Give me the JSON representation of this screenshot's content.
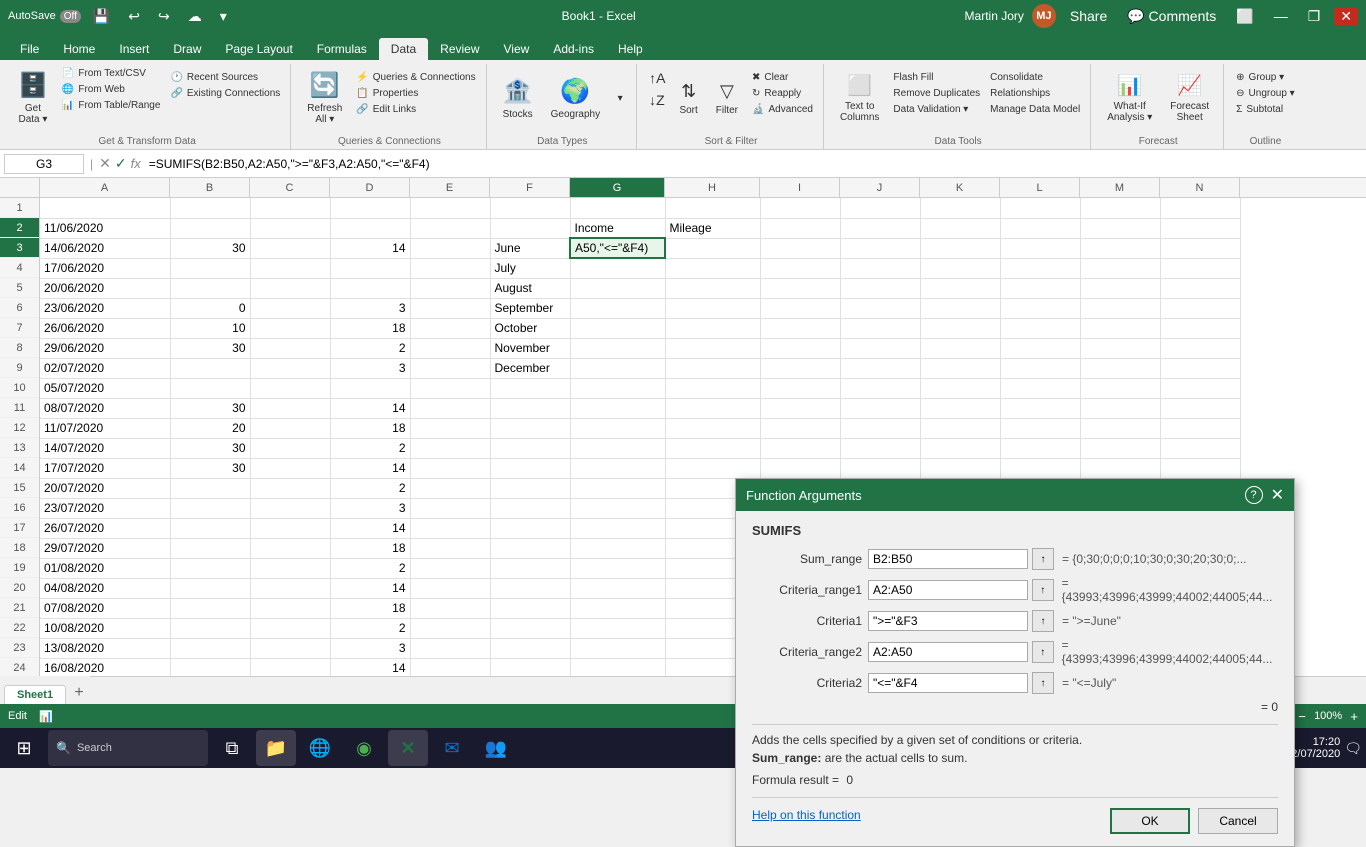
{
  "titlebar": {
    "autosave_label": "AutoSave",
    "autosave_state": "Off",
    "workbook_name": "Book1 - Excel",
    "user_name": "Martin Jory",
    "user_initials": "MJ",
    "minimize": "—",
    "restore": "❐",
    "close": "✕"
  },
  "ribbon": {
    "tabs": [
      "File",
      "Home",
      "Insert",
      "Draw",
      "Page Layout",
      "Formulas",
      "Data",
      "Review",
      "View",
      "Add-ins",
      "Help"
    ],
    "active_tab": "Data",
    "groups": {
      "get_transform": {
        "label": "Get & Transform Data",
        "buttons": [
          {
            "id": "get-data",
            "label": "Get\nData",
            "icon": "💾"
          },
          {
            "id": "from-text-csv",
            "label": "From Text/CSV",
            "icon": "📄"
          },
          {
            "id": "from-web",
            "label": "From Web",
            "icon": "🌐"
          },
          {
            "id": "from-table",
            "label": "From Table/Range",
            "icon": "📊"
          },
          {
            "id": "recent-sources",
            "label": "Recent Sources"
          },
          {
            "id": "existing-connections",
            "label": "Existing Connections"
          }
        ]
      },
      "queries": {
        "label": "Queries & Connections",
        "buttons": [
          {
            "id": "refresh-all",
            "label": "Refresh\nAll",
            "icon": "🔄"
          },
          {
            "id": "queries-connections",
            "label": "Queries & Connections"
          },
          {
            "id": "properties",
            "label": "Properties"
          },
          {
            "id": "edit-links",
            "label": "Edit Links"
          }
        ]
      },
      "data_types": {
        "label": "Data Types",
        "buttons": [
          {
            "id": "stocks",
            "label": "Stocks",
            "icon": "🏦"
          },
          {
            "id": "geography",
            "label": "Geography",
            "icon": "🌍"
          }
        ]
      },
      "sort_filter": {
        "label": "Sort & Filter",
        "buttons": [
          {
            "id": "sort-az",
            "label": "A→Z",
            "icon": "↑"
          },
          {
            "id": "sort-za",
            "label": "Z→A",
            "icon": "↓"
          },
          {
            "id": "sort",
            "label": "Sort"
          },
          {
            "id": "filter",
            "label": "Filter"
          },
          {
            "id": "clear",
            "label": "Clear"
          },
          {
            "id": "reapply",
            "label": "Reapply"
          },
          {
            "id": "advanced",
            "label": "Advanced"
          }
        ]
      },
      "data_tools": {
        "label": "Data Tools",
        "buttons": [
          {
            "id": "text-to-columns",
            "label": "Text to\nColumns",
            "icon": "⬜"
          },
          {
            "id": "flash-fill",
            "label": "Flash Fill"
          },
          {
            "id": "remove-duplicates",
            "label": "Remove Duplicates"
          },
          {
            "id": "data-validation",
            "label": "Data Validation"
          },
          {
            "id": "consolidate",
            "label": "Consolidate"
          },
          {
            "id": "relationships",
            "label": "Relationships"
          },
          {
            "id": "manage-data-model",
            "label": "Manage Data Model"
          }
        ]
      },
      "forecast": {
        "label": "Forecast",
        "buttons": [
          {
            "id": "what-if",
            "label": "What-If\nAnalysis"
          },
          {
            "id": "forecast-sheet",
            "label": "Forecast\nSheet"
          }
        ]
      },
      "outline": {
        "label": "Outline",
        "buttons": [
          {
            "id": "group",
            "label": "Group"
          },
          {
            "id": "ungroup",
            "label": "Ungroup"
          },
          {
            "id": "subtotal",
            "label": "Subtotal"
          }
        ]
      }
    }
  },
  "formula_bar": {
    "cell_ref": "G3",
    "formula": "=SUMIFS(B2:B50,A2:A50,\">=\"&F3,A2:A50,\"<=\"&F4)"
  },
  "columns": {
    "headers": [
      "A",
      "B",
      "C",
      "D",
      "E",
      "F",
      "G",
      "H",
      "I",
      "J",
      "K",
      "L",
      "M",
      "N"
    ],
    "widths": [
      130,
      80,
      80,
      80,
      80,
      80,
      95,
      95,
      80,
      80,
      80,
      80,
      80,
      80
    ]
  },
  "rows": [
    {
      "num": 2,
      "A": "11/06/2020",
      "B": "",
      "C": "",
      "D": "",
      "E": "",
      "F": "",
      "G": "Income",
      "H": "Mileage"
    },
    {
      "num": 3,
      "A": "14/06/2020",
      "B": "30",
      "C": "",
      "D": "14",
      "E": "",
      "F": "June",
      "G": "A50,\"<=\"&F4)",
      "H": ""
    },
    {
      "num": 4,
      "A": "17/06/2020",
      "B": "",
      "C": "",
      "D": "",
      "E": "",
      "F": "July",
      "G": "",
      "H": ""
    },
    {
      "num": 5,
      "A": "20/06/2020",
      "B": "",
      "C": "",
      "D": "",
      "E": "",
      "F": "August",
      "G": "",
      "H": ""
    },
    {
      "num": 6,
      "A": "23/06/2020",
      "B": "0",
      "C": "",
      "D": "3",
      "E": "",
      "F": "September",
      "G": "",
      "H": ""
    },
    {
      "num": 7,
      "A": "26/06/2020",
      "B": "10",
      "C": "",
      "D": "18",
      "E": "",
      "F": "October",
      "G": "",
      "H": ""
    },
    {
      "num": 8,
      "A": "29/06/2020",
      "B": "30",
      "C": "",
      "D": "2",
      "E": "",
      "F": "November",
      "G": "",
      "H": ""
    },
    {
      "num": 9,
      "A": "02/07/2020",
      "B": "",
      "C": "",
      "D": "3",
      "E": "",
      "F": "December",
      "G": "",
      "H": ""
    },
    {
      "num": 10,
      "A": "05/07/2020",
      "B": "",
      "C": "",
      "D": "",
      "E": "",
      "F": "",
      "G": "",
      "H": ""
    },
    {
      "num": 11,
      "A": "08/07/2020",
      "B": "30",
      "C": "",
      "D": "14",
      "E": "",
      "F": "",
      "G": "",
      "H": ""
    },
    {
      "num": 12,
      "A": "11/07/2020",
      "B": "20",
      "C": "",
      "D": "18",
      "E": "",
      "F": "",
      "G": "",
      "H": ""
    },
    {
      "num": 13,
      "A": "14/07/2020",
      "B": "30",
      "C": "",
      "D": "2",
      "E": "",
      "F": "",
      "G": "",
      "H": ""
    },
    {
      "num": 14,
      "A": "17/07/2020",
      "B": "30",
      "C": "",
      "D": "14",
      "E": "",
      "F": "",
      "G": "",
      "H": ""
    },
    {
      "num": 15,
      "A": "20/07/2020",
      "B": "",
      "C": "",
      "D": "2",
      "E": "",
      "F": "",
      "G": "",
      "H": ""
    },
    {
      "num": 16,
      "A": "23/07/2020",
      "B": "",
      "C": "",
      "D": "3",
      "E": "",
      "F": "",
      "G": "",
      "H": ""
    },
    {
      "num": 17,
      "A": "26/07/2020",
      "B": "",
      "C": "",
      "D": "14",
      "E": "",
      "F": "",
      "G": "",
      "H": ""
    },
    {
      "num": 18,
      "A": "29/07/2020",
      "B": "",
      "C": "",
      "D": "18",
      "E": "",
      "F": "",
      "G": "",
      "H": ""
    },
    {
      "num": 19,
      "A": "01/08/2020",
      "B": "",
      "C": "",
      "D": "2",
      "E": "",
      "F": "",
      "G": "",
      "H": ""
    },
    {
      "num": 20,
      "A": "04/08/2020",
      "B": "",
      "C": "",
      "D": "14",
      "E": "",
      "F": "",
      "G": "",
      "H": ""
    },
    {
      "num": 21,
      "A": "07/08/2020",
      "B": "",
      "C": "",
      "D": "18",
      "E": "",
      "F": "",
      "G": "",
      "H": ""
    },
    {
      "num": 22,
      "A": "10/08/2020",
      "B": "",
      "C": "",
      "D": "2",
      "E": "",
      "F": "",
      "G": "",
      "H": ""
    },
    {
      "num": 23,
      "A": "13/08/2020",
      "B": "",
      "C": "",
      "D": "3",
      "E": "",
      "F": "",
      "G": "",
      "H": ""
    },
    {
      "num": 24,
      "A": "16/08/2020",
      "B": "",
      "C": "",
      "D": "14",
      "E": "",
      "F": "",
      "G": "",
      "H": ""
    }
  ],
  "dialog": {
    "title": "Function Arguments",
    "help_icon": "?",
    "close_icon": "✕",
    "func_name": "SUMIFS",
    "fields": [
      {
        "label": "Sum_range",
        "value": "B2:B50",
        "result": "= {0;30;0;0;0;10;30;0;30;20;30;0;..."
      },
      {
        "label": "Criteria_range1",
        "value": "A2:A50",
        "result": "= {43993;43996;43999;44002;44005;44..."
      },
      {
        "label": "Criteria1",
        "value": "\">=\" & F3",
        "result": "= \">= June\""
      },
      {
        "label": "Criteria_range2",
        "value": "A2:A50",
        "result": "= {43993;43996;43999;44002;44005;44..."
      },
      {
        "label": "Criteria2",
        "value": "\"<=\" & F4",
        "result": "= \"<= July\""
      }
    ],
    "equals_result": "= 0",
    "description": "Adds the cells specified by a given set of conditions or criteria.",
    "param_name": "Sum_range:",
    "param_desc": "are the actual cells to sum.",
    "formula_result_label": "Formula result =",
    "formula_result_value": "0",
    "help_link": "Help on this function",
    "ok_label": "OK",
    "cancel_label": "Cancel"
  },
  "sheet_tabs": [
    {
      "id": "sheet1",
      "label": "Sheet1",
      "active": true
    }
  ],
  "add_sheet_label": "+",
  "status_bar": {
    "left": "Edit",
    "mode_icon": "📊",
    "zoom": "100%",
    "zoom_out": "−",
    "zoom_in": "+"
  },
  "taskbar": {
    "time": "17:20",
    "date": "12/07/2020",
    "items": [
      {
        "id": "start",
        "icon": "⊞",
        "label": "Start"
      },
      {
        "id": "explorer",
        "icon": "📁",
        "label": "File Explorer"
      },
      {
        "id": "edge",
        "icon": "🌐",
        "label": "Edge"
      },
      {
        "id": "chrome",
        "icon": "◉",
        "label": "Chrome"
      },
      {
        "id": "excel",
        "icon": "✕",
        "label": "Excel"
      },
      {
        "id": "outlook",
        "icon": "✉",
        "label": "Outlook"
      },
      {
        "id": "teams",
        "icon": "👥",
        "label": "Teams"
      }
    ]
  }
}
